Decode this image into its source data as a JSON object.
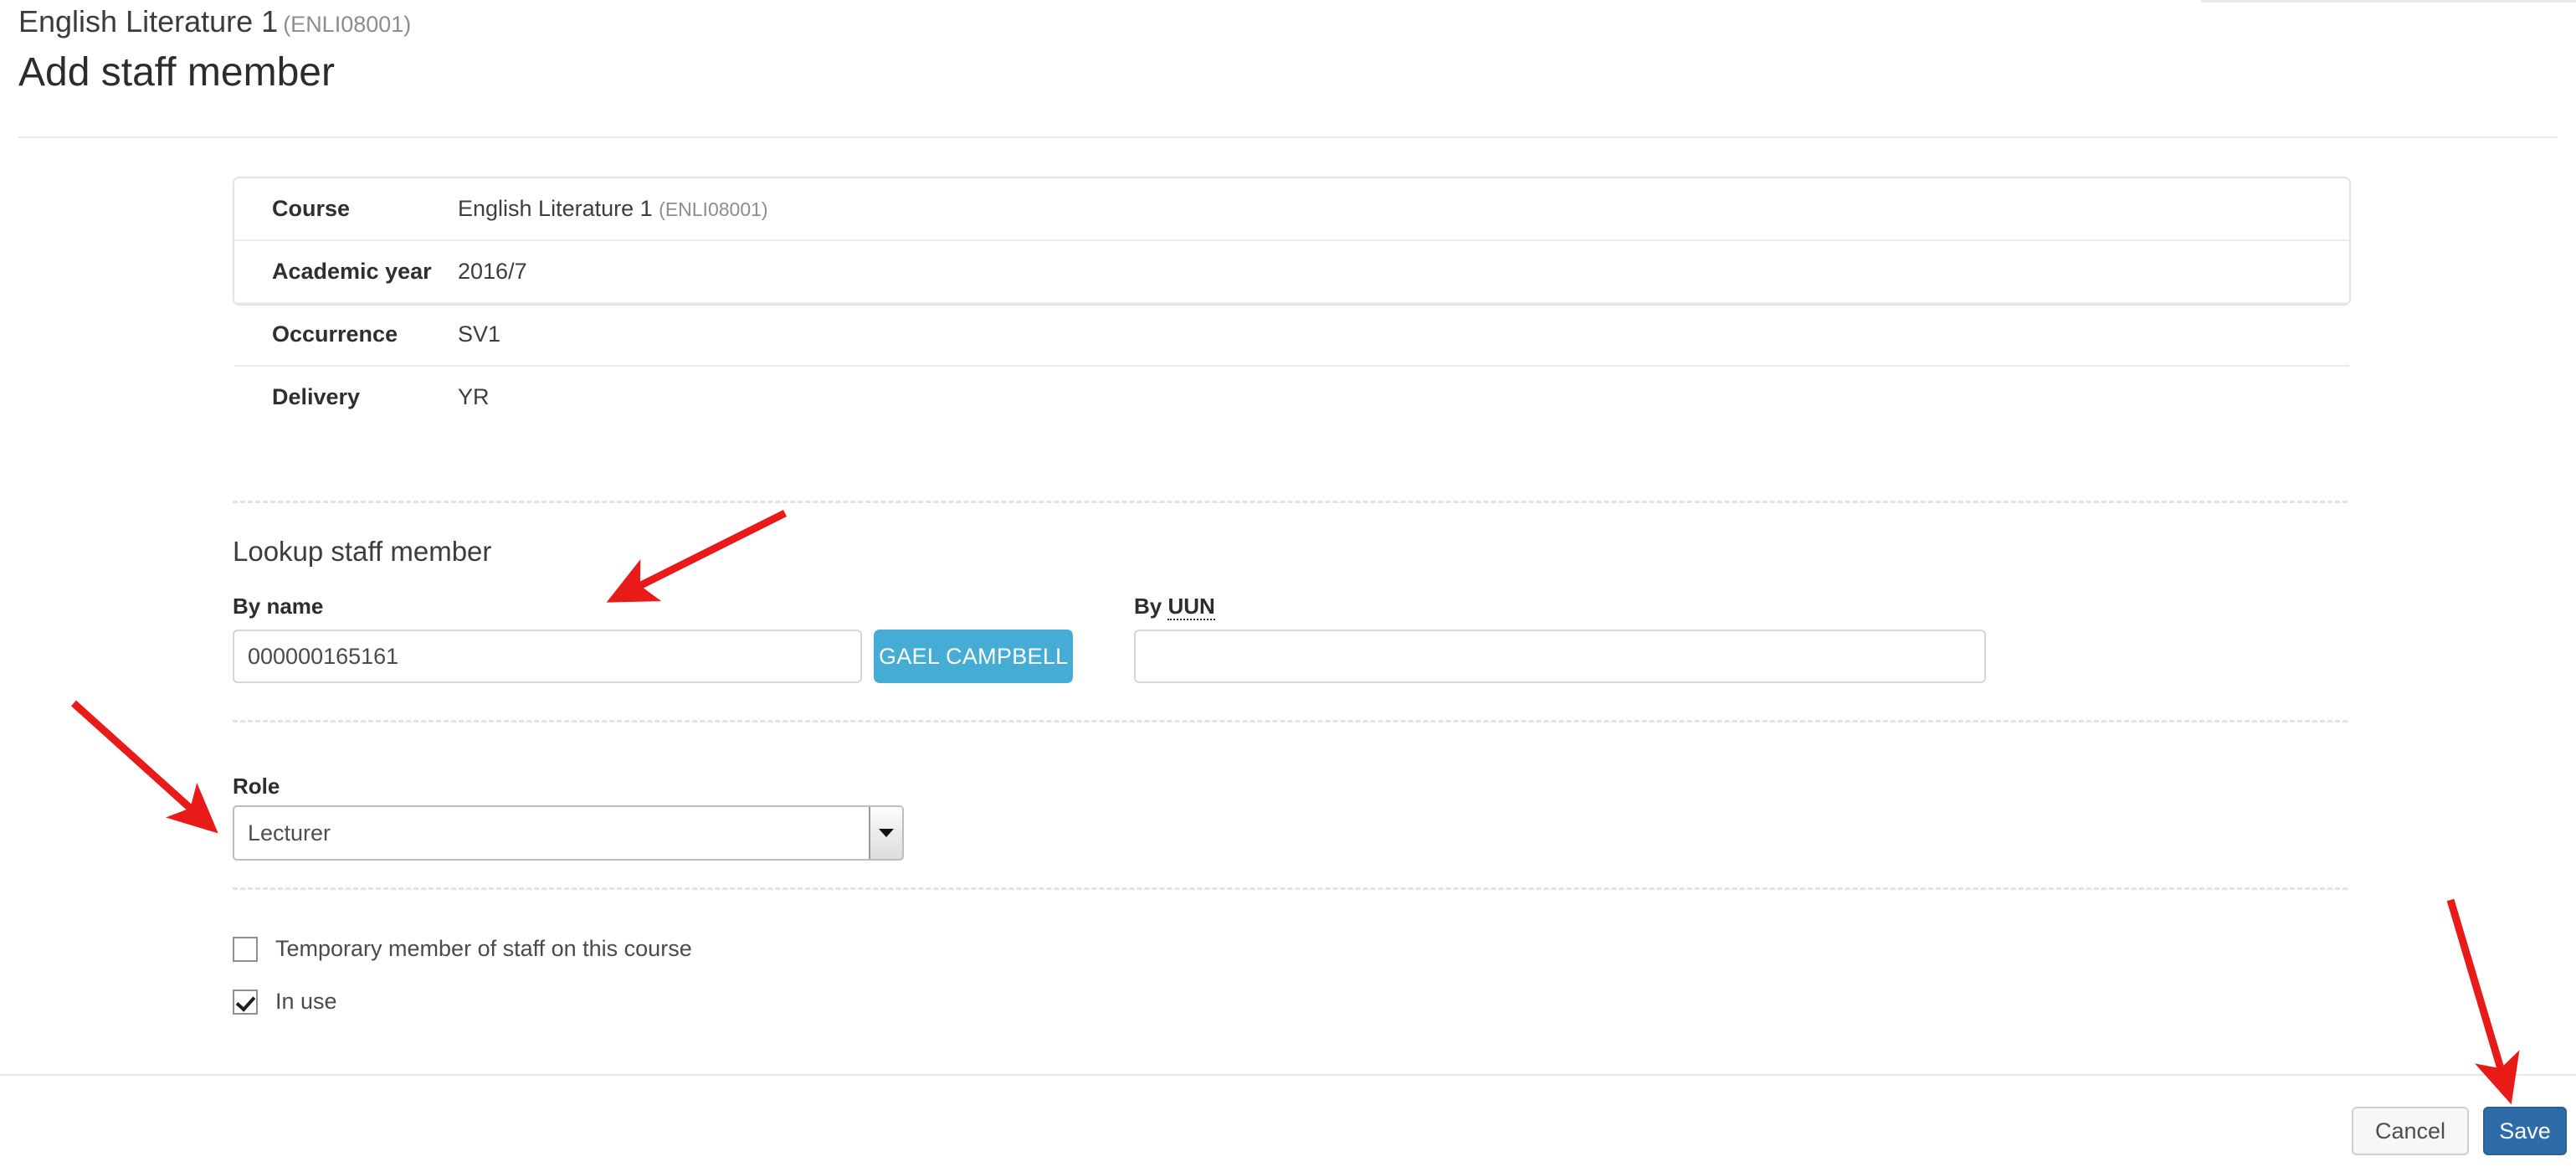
{
  "header": {
    "course_name": "English Literature 1",
    "course_code": "(ENLI08001)",
    "page_title": "Add staff member"
  },
  "info_card": {
    "rows": [
      {
        "label": "Course",
        "value": "English Literature 1",
        "value_suffix": "(ENLI08001)"
      },
      {
        "label": "Academic year",
        "value": "2016/7",
        "value_suffix": ""
      },
      {
        "label": "Occurrence",
        "value": "SV1",
        "value_suffix": ""
      },
      {
        "label": "Delivery",
        "value": "YR",
        "value_suffix": ""
      }
    ]
  },
  "lookup": {
    "heading": "Lookup staff member",
    "by_name_label": "By name",
    "by_name_value": "000000165161",
    "by_name_placeholder": "",
    "result_button_label": "GAEL CAMPBELL",
    "by_uun_label_prefix": "By ",
    "by_uun_label_abbr": "UUN",
    "by_uun_value": "",
    "by_uun_placeholder": ""
  },
  "role": {
    "label": "Role",
    "selected": "Lecturer"
  },
  "checkboxes": [
    {
      "label": "Temporary member of staff on this course",
      "checked": false
    },
    {
      "label": "In use",
      "checked": true
    }
  ],
  "footer": {
    "cancel_label": "Cancel",
    "save_label": "Save"
  },
  "colors": {
    "lookup_result_blue": "#45add5",
    "save_blue": "#2d6ca9",
    "annotation_red": "#e81b18",
    "border_grey": "#e2e2e2"
  },
  "annotations": [
    {
      "name": "arrow-to-by-name-field",
      "points_to": "by-name-input"
    },
    {
      "name": "arrow-to-role-select",
      "points_to": "role-select"
    },
    {
      "name": "arrow-to-save-button",
      "points_to": "save-button"
    }
  ]
}
